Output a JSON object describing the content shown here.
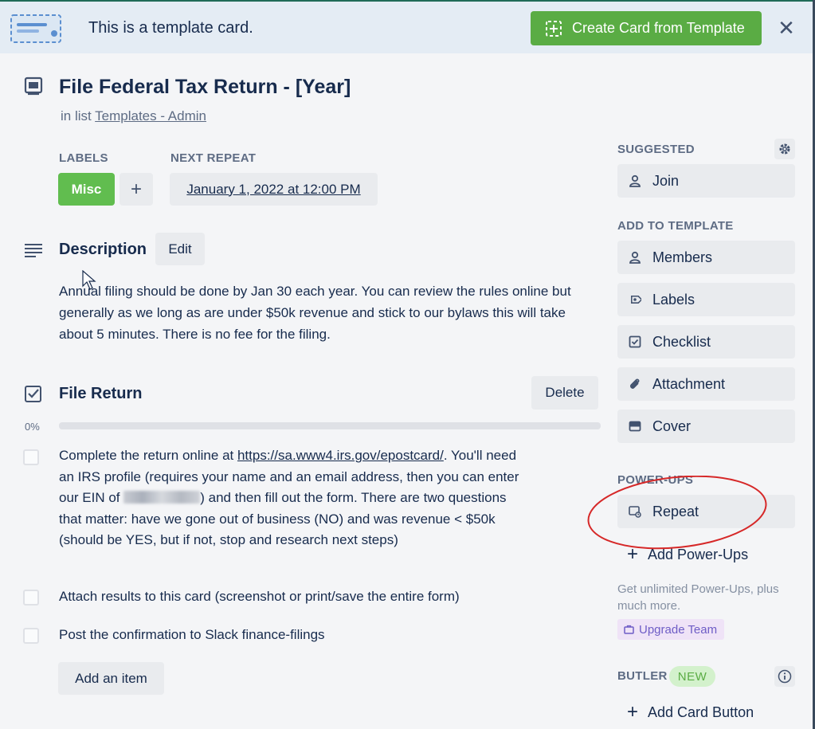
{
  "banner": {
    "text": "This is a template card.",
    "create_button": "Create Card from Template"
  },
  "card": {
    "title": "File Federal Tax Return - [Year]",
    "list_prefix": "in list",
    "list_name": "Templates - Admin"
  },
  "labels": {
    "heading": "LABELS",
    "items": [
      "Misc"
    ],
    "misc_color": "#61bd4f"
  },
  "next_repeat": {
    "heading": "NEXT REPEAT",
    "value": "January 1, 2022 at 12:00 PM"
  },
  "description": {
    "heading": "Description",
    "edit_label": "Edit",
    "text": "Annual filing should be done by Jan 30 each year. You can review the rules online but generally as we long as are under $50k revenue and stick to our bylaws this will take about 5 minutes. There is no fee for the filing."
  },
  "checklist": {
    "title": "File Return",
    "delete_label": "Delete",
    "progress_percent": "0%",
    "progress_value": 0,
    "items": [
      {
        "pre_link": "Complete the return online at ",
        "link": "https://sa.www4.irs.gov/epostcard/",
        "post_link_1": ". You'll need an IRS profile (requires your name and an email address, then you can enter our EIN of ",
        "post_link_2": ") and then fill out the form. There are two questions that matter: have we gone out of business (NO) and was revenue < $50k (should be YES, but if not, stop and research next steps)"
      },
      {
        "text": "Attach results to this card (screenshot or print/save the entire form)"
      },
      {
        "text": "Post the confirmation to Slack finance-filings"
      }
    ],
    "add_item_label": "Add an item"
  },
  "sidebar": {
    "suggested_heading": "SUGGESTED",
    "join_label": "Join",
    "add_to_template_heading": "ADD TO TEMPLATE",
    "add_items": [
      {
        "label": "Members",
        "icon": "person-icon"
      },
      {
        "label": "Labels",
        "icon": "tag-icon"
      },
      {
        "label": "Checklist",
        "icon": "checkbox-icon"
      },
      {
        "label": "Attachment",
        "icon": "paperclip-icon"
      },
      {
        "label": "Cover",
        "icon": "cover-icon"
      }
    ],
    "power_ups_heading": "POWER-UPS",
    "repeat_label": "Repeat",
    "add_power_ups_label": "Add Power-Ups",
    "upsell_text": "Get unlimited Power-Ups, plus much more.",
    "upgrade_label": "Upgrade Team",
    "butler_heading": "BUTLER",
    "new_badge": "NEW",
    "add_card_button_label": "Add Card Button"
  },
  "colors": {
    "accent_green": "#5aac44",
    "annotation_red": "#d62828"
  }
}
